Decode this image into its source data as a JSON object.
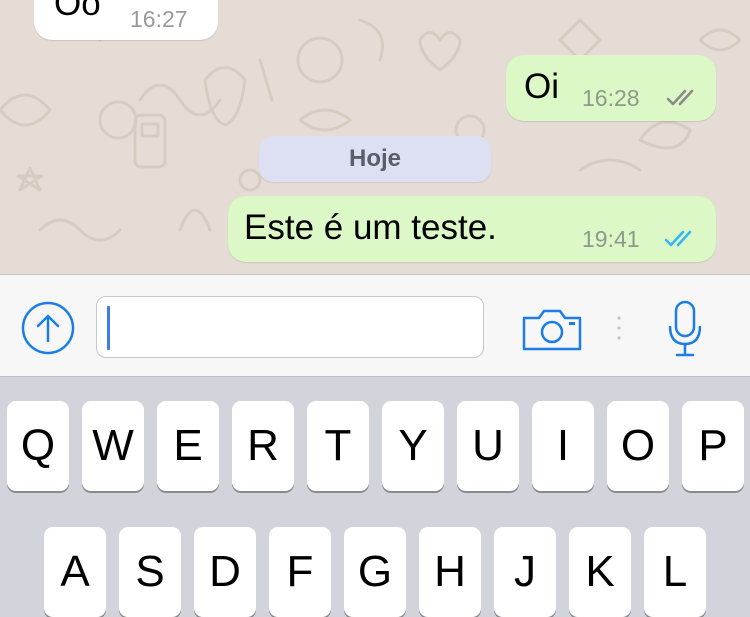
{
  "colors": {
    "chat_background": "#e5ddd5",
    "incoming_bubble": "#ffffff",
    "outgoing_bubble": "#dcf8c6",
    "date_pill": "#dde0f2",
    "read_ticks": "#34b7f1",
    "delivered_ticks": "#8a8a8a",
    "accent": "#1a7ee6"
  },
  "messages": [
    {
      "direction": "incoming",
      "text": "Oo",
      "time": "16:27"
    },
    {
      "direction": "outgoing",
      "text": "Oi",
      "time": "16:28",
      "status": "delivered",
      "status_icon": "double-check-gray-icon"
    },
    {
      "direction": "outgoing",
      "text": "Este é um teste.",
      "time": "19:41",
      "status": "read",
      "status_icon": "double-check-blue-icon"
    }
  ],
  "date_separator": "Hoje",
  "composer": {
    "input_value": "",
    "attach_icon": "arrow-up-circle-icon",
    "camera_icon": "camera-icon",
    "mic_icon": "microphone-icon"
  },
  "keyboard": {
    "row1": [
      "Q",
      "W",
      "E",
      "R",
      "T",
      "Y",
      "U",
      "I",
      "O",
      "P"
    ],
    "row2": [
      "A",
      "S",
      "D",
      "F",
      "G",
      "H",
      "J",
      "K",
      "L"
    ]
  }
}
